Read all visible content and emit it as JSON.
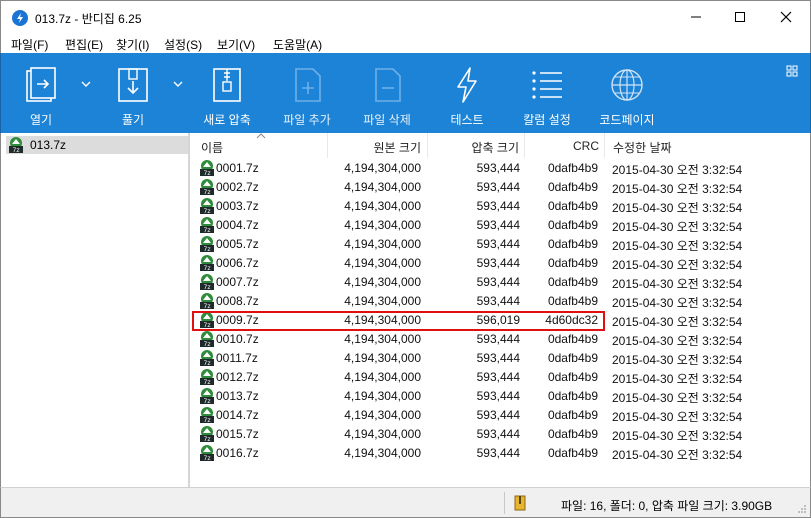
{
  "window": {
    "title": "013.7z - 반디집 6.25",
    "minimize_icon": "minimize-icon",
    "maximize_icon": "maximize-icon",
    "close_icon": "close-icon"
  },
  "menu": [
    "파일(F)",
    "편집(E)",
    "찾기(I)",
    "설정(S)",
    "보기(V)",
    "도움말(A)"
  ],
  "toolbar": {
    "open": "열기",
    "extract": "풀기",
    "new_archive": "새로 압축",
    "add_file": "파일 추가",
    "delete_file": "파일 삭제",
    "test": "테스트",
    "column_settings": "칼럼 설정",
    "codepage": "코드페이지",
    "background": "#1d83d6"
  },
  "tree": {
    "root": "013.7z"
  },
  "columns": {
    "name": "이름",
    "original_size": "원본 크기",
    "compressed_size": "압축 크기",
    "crc": "CRC",
    "modified": "수정한 날짜"
  },
  "files": [
    {
      "name": "0001.7z",
      "original": "4,194,304,000",
      "compressed": "593,444",
      "crc": "0dafb4b9",
      "modified": "2015-04-30 오전 3:32:54"
    },
    {
      "name": "0002.7z",
      "original": "4,194,304,000",
      "compressed": "593,444",
      "crc": "0dafb4b9",
      "modified": "2015-04-30 오전 3:32:54"
    },
    {
      "name": "0003.7z",
      "original": "4,194,304,000",
      "compressed": "593,444",
      "crc": "0dafb4b9",
      "modified": "2015-04-30 오전 3:32:54"
    },
    {
      "name": "0004.7z",
      "original": "4,194,304,000",
      "compressed": "593,444",
      "crc": "0dafb4b9",
      "modified": "2015-04-30 오전 3:32:54"
    },
    {
      "name": "0005.7z",
      "original": "4,194,304,000",
      "compressed": "593,444",
      "crc": "0dafb4b9",
      "modified": "2015-04-30 오전 3:32:54"
    },
    {
      "name": "0006.7z",
      "original": "4,194,304,000",
      "compressed": "593,444",
      "crc": "0dafb4b9",
      "modified": "2015-04-30 오전 3:32:54"
    },
    {
      "name": "0007.7z",
      "original": "4,194,304,000",
      "compressed": "593,444",
      "crc": "0dafb4b9",
      "modified": "2015-04-30 오전 3:32:54"
    },
    {
      "name": "0008.7z",
      "original": "4,194,304,000",
      "compressed": "593,444",
      "crc": "0dafb4b9",
      "modified": "2015-04-30 오전 3:32:54"
    },
    {
      "name": "0009.7z",
      "original": "4,194,304,000",
      "compressed": "596,019",
      "crc": "4d60dc32",
      "modified": "2015-04-30 오전 3:32:54"
    },
    {
      "name": "0010.7z",
      "original": "4,194,304,000",
      "compressed": "593,444",
      "crc": "0dafb4b9",
      "modified": "2015-04-30 오전 3:32:54"
    },
    {
      "name": "0011.7z",
      "original": "4,194,304,000",
      "compressed": "593,444",
      "crc": "0dafb4b9",
      "modified": "2015-04-30 오전 3:32:54"
    },
    {
      "name": "0012.7z",
      "original": "4,194,304,000",
      "compressed": "593,444",
      "crc": "0dafb4b9",
      "modified": "2015-04-30 오전 3:32:54"
    },
    {
      "name": "0013.7z",
      "original": "4,194,304,000",
      "compressed": "593,444",
      "crc": "0dafb4b9",
      "modified": "2015-04-30 오전 3:32:54"
    },
    {
      "name": "0014.7z",
      "original": "4,194,304,000",
      "compressed": "593,444",
      "crc": "0dafb4b9",
      "modified": "2015-04-30 오전 3:32:54"
    },
    {
      "name": "0015.7z",
      "original": "4,194,304,000",
      "compressed": "593,444",
      "crc": "0dafb4b9",
      "modified": "2015-04-30 오전 3:32:54"
    },
    {
      "name": "0016.7z",
      "original": "4,194,304,000",
      "compressed": "593,444",
      "crc": "0dafb4b9",
      "modified": "2015-04-30 오전 3:32:54"
    }
  ],
  "status": {
    "text": "파일: 16, 폴더: 0, 압축 파일 크기: 3.90GB"
  },
  "colors": {
    "highlight_border": "#e01010",
    "archive_icon": "#2e8b3a"
  }
}
